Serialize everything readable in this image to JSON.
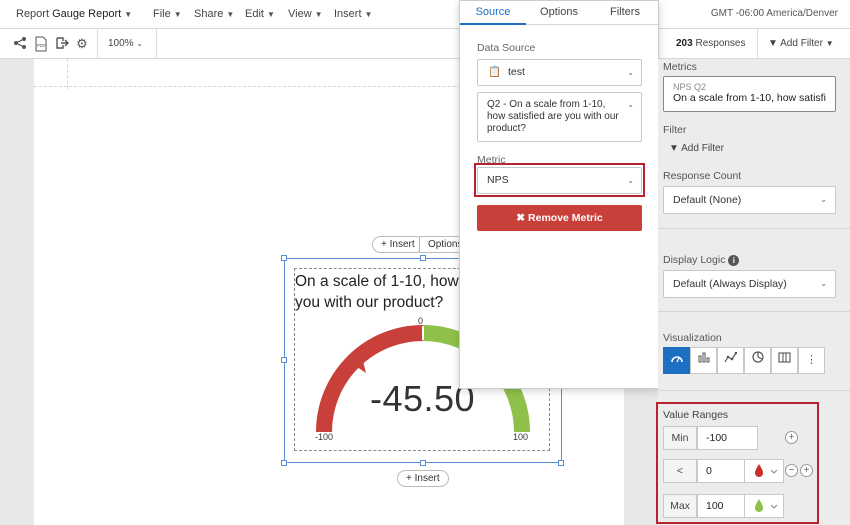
{
  "menubar": {
    "report_prefix": "Report",
    "report_name": "Gauge Report",
    "menus": [
      "File",
      "Share",
      "Edit",
      "View",
      "Insert"
    ],
    "timezone": "GMT -06:00 America/Denver"
  },
  "toolbar": {
    "zoom": "100%",
    "responses_count": "203",
    "responses_label": "Responses",
    "add_filter": "Add Filter"
  },
  "widget": {
    "insert_top": "Insert",
    "options": "Options",
    "insert_bottom": "Insert",
    "title": "On a scale of 1-10, how you with our product?",
    "gauge": {
      "value": "-45.50",
      "min_label": "-100",
      "max_label": "100",
      "zero_label": "0",
      "colors": {
        "negative": "#c9403a",
        "positive": "#8fc14a"
      }
    }
  },
  "popover": {
    "tabs": [
      "Source",
      "Options",
      "Filters"
    ],
    "active_tab": "Source",
    "data_source_label": "Data Source",
    "data_source_value": "test",
    "question_value": "Q2 - On a scale from 1-10, how satisfied are you with our product?",
    "metric_label": "Metric",
    "metric_value": "NPS",
    "remove_metric": "Remove Metric"
  },
  "right_panel": {
    "metrics_label": "Metrics",
    "metric_sub": "NPS Q2",
    "metric_main": "On a scale from 1-10, how satisfie...",
    "filter_label": "Filter",
    "add_filter": "Add Filter",
    "response_count_label": "Response Count",
    "response_count_value": "Default (None)",
    "display_logic_label": "Display Logic",
    "display_logic_value": "Default (Always Display)",
    "visualization_label": "Visualization",
    "value_ranges_label": "Value Ranges",
    "ranges": {
      "min_key": "Min",
      "min_value": "-100",
      "mid_key": "<",
      "mid_value": "0",
      "max_key": "Max",
      "max_value": "100"
    }
  },
  "colors": {
    "accent": "#1d6fc4",
    "danger": "#c9403a",
    "highlight_box": "#b5242e",
    "drop_red": "#c9302c",
    "drop_green": "#8fc14a"
  }
}
